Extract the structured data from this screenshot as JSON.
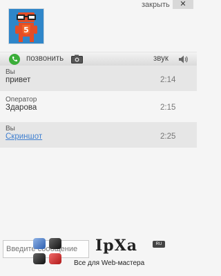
{
  "header": {
    "close_label": "закрыть",
    "close_icon": "close-icon"
  },
  "toolbar": {
    "call_label": "позвонить",
    "sound_label": "звук",
    "call_icon": "phone-icon",
    "camera_icon": "camera-icon",
    "speaker_icon": "speaker-icon"
  },
  "messages": [
    {
      "author": "Вы",
      "text": "привет",
      "time": "2:14"
    },
    {
      "author": "Оператор",
      "text": "Здарова",
      "time": "2:15"
    },
    {
      "author": "Вы",
      "text": "Скриншот",
      "time": "2:25"
    }
  ],
  "input": {
    "placeholder": "Введите сообщение"
  },
  "watermark": {
    "title": "IpXa",
    "badge": "RU",
    "subtitle": "Все для Web-мастера"
  },
  "colors": {
    "accent_link": "#3f7fd0",
    "avatar_bg": "#2f86c9",
    "html5_orange": "#e44d26"
  }
}
